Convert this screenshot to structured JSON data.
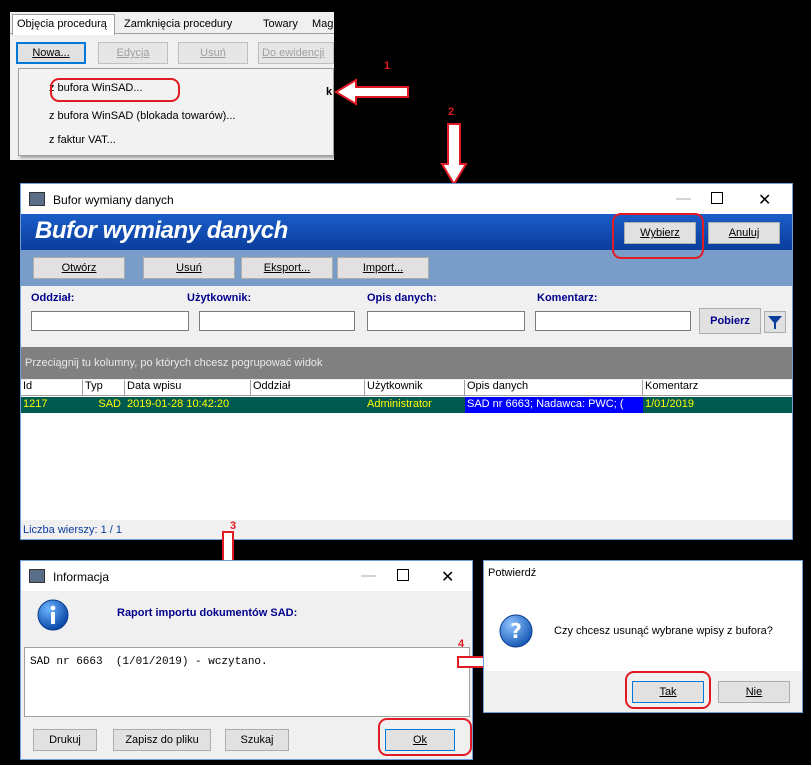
{
  "tabs": [
    "Objęcia procedurą",
    "Zamknięcia procedury",
    "Towary",
    "Mag"
  ],
  "toolbar": {
    "nowa": "Nowa...",
    "edycja": "Edycja",
    "usun": "Usuń",
    "do_ewidencji": "Do ewidencji",
    "truncated": "k"
  },
  "menu": [
    "z bufora WinSAD...",
    "z bufora WinSAD (blokada towarów)...",
    "z faktur VAT..."
  ],
  "markers": [
    "1",
    "2",
    "3",
    "4"
  ],
  "buffer_window": {
    "title": "Bufor wymiany danych",
    "banner": "Bufor wymiany danych",
    "wybierz": "Wybierz",
    "anuluj": "Anuluj",
    "actions": [
      "Otwórz",
      "Usuń",
      "Eksport...",
      "Import..."
    ],
    "filters": {
      "oddzial": "Oddział:",
      "uzytkownik": "Użytkownik:",
      "opis": "Opis danych:",
      "komentarz": "Komentarz:"
    },
    "pobierz": "Pobierz",
    "group_hint": "Przeciągnij tu kolumny, po których chcesz pogrupować widok",
    "columns": [
      "Id",
      "Typ",
      "Data wpisu",
      "Oddział",
      "Użytkownik",
      "Opis danych",
      "Komentarz"
    ],
    "rows": [
      [
        "1217",
        "SAD",
        "2019-01-28 10:42:20",
        "",
        "Administrator",
        "SAD nr 6663; Nadawca: PWC; (",
        "1/01/2019"
      ]
    ],
    "row_count": "Liczba wierszy: 1 / 1"
  },
  "info_window": {
    "title": "Informacja",
    "heading": "Raport importu dokumentów SAD:",
    "report": "SAD nr 6663  (1/01/2019) - wczytano.",
    "drukuj": "Drukuj",
    "zapisz": "Zapisz do pliku",
    "szukaj": "Szukaj",
    "ok": "Ok"
  },
  "confirm_window": {
    "title": "Potwierdź",
    "question": "Czy chcesz usunąć wybrane wpisy z bufora?",
    "tak": "Tak",
    "nie": "Nie"
  },
  "colors": {
    "accent_red": "#e01b24",
    "banner_blue": "#0a3d9c",
    "row_bg": "#005a50",
    "row_text": "#ffff00",
    "row_selected_bg": "#0000ff"
  }
}
